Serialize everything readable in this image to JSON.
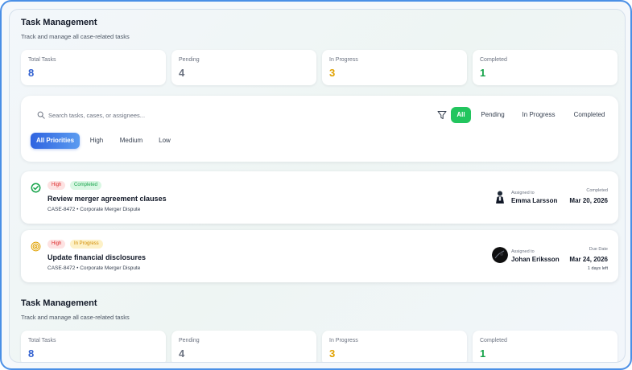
{
  "header": {
    "title": "Task Management",
    "subtitle": "Track and manage all case-related tasks"
  },
  "stats": [
    {
      "label": "Total Tasks",
      "value": "8",
      "color": "#2f5fd0"
    },
    {
      "label": "Pending",
      "value": "4",
      "color": "#6b7280"
    },
    {
      "label": "In Progress",
      "value": "3",
      "color": "#e0a100"
    },
    {
      "label": "Completed",
      "value": "1",
      "color": "#16a34a"
    }
  ],
  "search": {
    "placeholder": "Search tasks, cases, or assignees...",
    "value": ""
  },
  "status_filters": {
    "selected": "All",
    "options": [
      "All",
      "Pending",
      "In Progress",
      "Completed"
    ]
  },
  "priority_filters": {
    "selected": "All Priorities",
    "options": [
      "All Priorities",
      "High",
      "Medium",
      "Low"
    ]
  },
  "tasks": [
    {
      "priority": "High",
      "status": "Completed",
      "status_icon": "check-circle-icon",
      "title": "Review merger agreement clauses",
      "case": "CASE-8472 • Corporate Merger Dispute",
      "assigned_label": "Assigned to",
      "assignee": "Emma Larsson",
      "date_label": "Completed",
      "date": "Mar 20, 2026",
      "date_extra": ""
    },
    {
      "priority": "High",
      "status": "In Progress",
      "status_icon": "in-progress-target-icon",
      "title": "Update financial disclosures",
      "case": "CASE-8472 • Corporate Merger Dispute",
      "assigned_label": "Assigned to",
      "assignee": "Johan Eriksson",
      "date_label": "Due Date",
      "date": "Mar 24, 2026",
      "date_extra": "1 days left"
    }
  ],
  "colors": {
    "accent_green": "#22c55e",
    "accent_blue": "#2f64e0",
    "frame_border": "#4a8fe6"
  }
}
